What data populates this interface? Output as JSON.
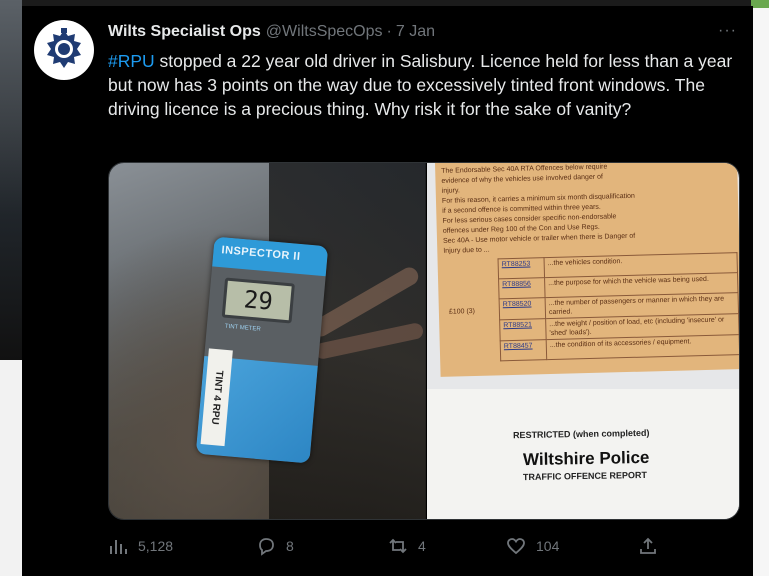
{
  "tweet": {
    "display_name": "Wilts Specialist Ops",
    "handle": "@WiltsSpecOps",
    "separator": "·",
    "date": "7 Jan",
    "more": "···",
    "hashtag": "#RPU",
    "text": " stopped a 22 year old driver in Salisbury. Licence held for less than a year but now has 3 points on the way due to excessively tinted front windows. The driving licence is a precious thing. Why risk it for the sake of vanity?"
  },
  "media": {
    "left_photo": {
      "meter_brand": "INSPECTOR II",
      "meter_reading": "29",
      "meter_sub": "TINT METER",
      "tag_text": "TINT 4 RPU"
    },
    "right_photo": {
      "form_lines": [
        "The Endorsable Sec 40A RTA Offences below require",
        "evidence of why the vehicles use involved danger of",
        "injury.",
        "For this reason, it carries a minimum six month disqualification",
        "if a second offence is committed within three years.",
        "For less serious cases consider specific non-endorsable",
        "offences under Reg 100 of the Con and Use Regs.",
        "Sec 40A - Use motor vehicle or trailer when there is Danger of",
        "Injury due to ..."
      ],
      "fine": "£100 (3)",
      "offences": [
        {
          "code": "RT88253",
          "desc": "...the vehicles condition."
        },
        {
          "code": "RT88856",
          "desc": "...the purpose for which the vehicle was being used."
        },
        {
          "code": "RT88520",
          "desc": "...the number of passengers or manner in which they are carried."
        },
        {
          "code": "RT88521",
          "desc": "...the weight / position of load, etc (including 'insecure' or 'shed' loads')."
        },
        {
          "code": "RT88457",
          "desc": "...the condition of its accessories / equipment."
        }
      ],
      "restricted": "RESTRICTED (when completed)",
      "police": "Wiltshire Police",
      "report": "TRAFFIC OFFENCE REPORT"
    }
  },
  "actions": {
    "views": "5,128",
    "replies": "8",
    "retweets": "4",
    "likes": "104"
  },
  "colors": {
    "background": "#000000",
    "accent": "#1d9bf0",
    "muted": "#71767b",
    "text": "#e7e9ea"
  }
}
